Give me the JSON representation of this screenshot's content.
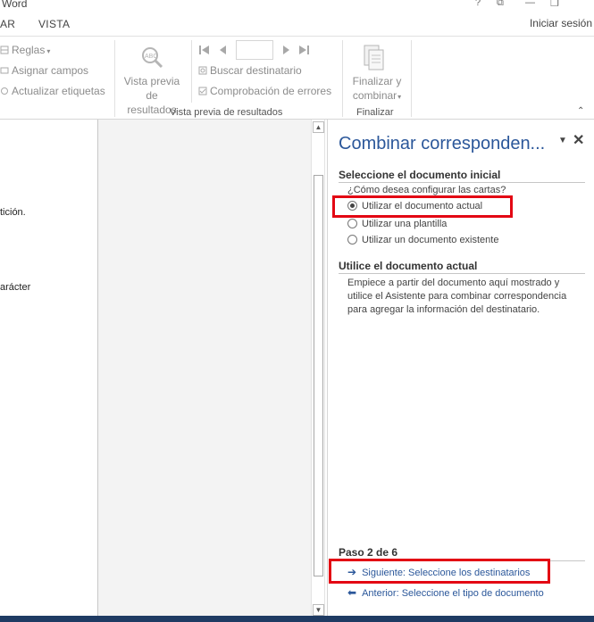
{
  "window": {
    "title": "Word",
    "buttons": {
      "help": "?",
      "restore_ribbon": "⧉",
      "minimize": "—",
      "maximize": "❐"
    }
  },
  "tabs": [
    {
      "label": "AR"
    },
    {
      "label": "VISTA"
    }
  ],
  "account": {
    "signin": "Iniciar sesión"
  },
  "ribbon": {
    "write_group": {
      "rules": "Reglas",
      "match_fields": "Asignar campos",
      "update_labels": "Actualizar etiquetas"
    },
    "preview_group": {
      "preview_results_line1": "Vista previa",
      "preview_results_line2": "de resultados",
      "find_recipient": "Buscar destinatario",
      "check_errors": "Comprobación de errores",
      "record_value": "",
      "label": "Vista previa de resultados"
    },
    "finish_group": {
      "finish_line1": "Finalizar y",
      "finish_line2": "combinar",
      "label": "Finalizar"
    }
  },
  "document": {
    "fragments": [
      "tición.",
      "arácter"
    ]
  },
  "task_pane": {
    "title": "Combinar corresponden...",
    "menu_icon": "▼",
    "close_icon": "✕",
    "section1": {
      "heading": "Seleccione el documento inicial",
      "question": "¿Cómo desea configurar las cartas?",
      "options": [
        {
          "label": "Utilizar el documento actual",
          "checked": true
        },
        {
          "label": "Utilizar una plantilla",
          "checked": false
        },
        {
          "label": "Utilizar un documento existente",
          "checked": false
        }
      ]
    },
    "section2": {
      "heading": "Utilice el documento actual",
      "description": "Empiece a partir del documento aquí mostrado y utilice el Asistente para combinar correspondencia para agregar la información del destinatario."
    },
    "step": "Paso 2 de 6",
    "next_link": "Siguiente: Seleccione los destinatarios",
    "prev_link": "Anterior: Seleccione el tipo de documento"
  },
  "colors": {
    "accent": "#2b579a",
    "highlight": "#e30613"
  }
}
